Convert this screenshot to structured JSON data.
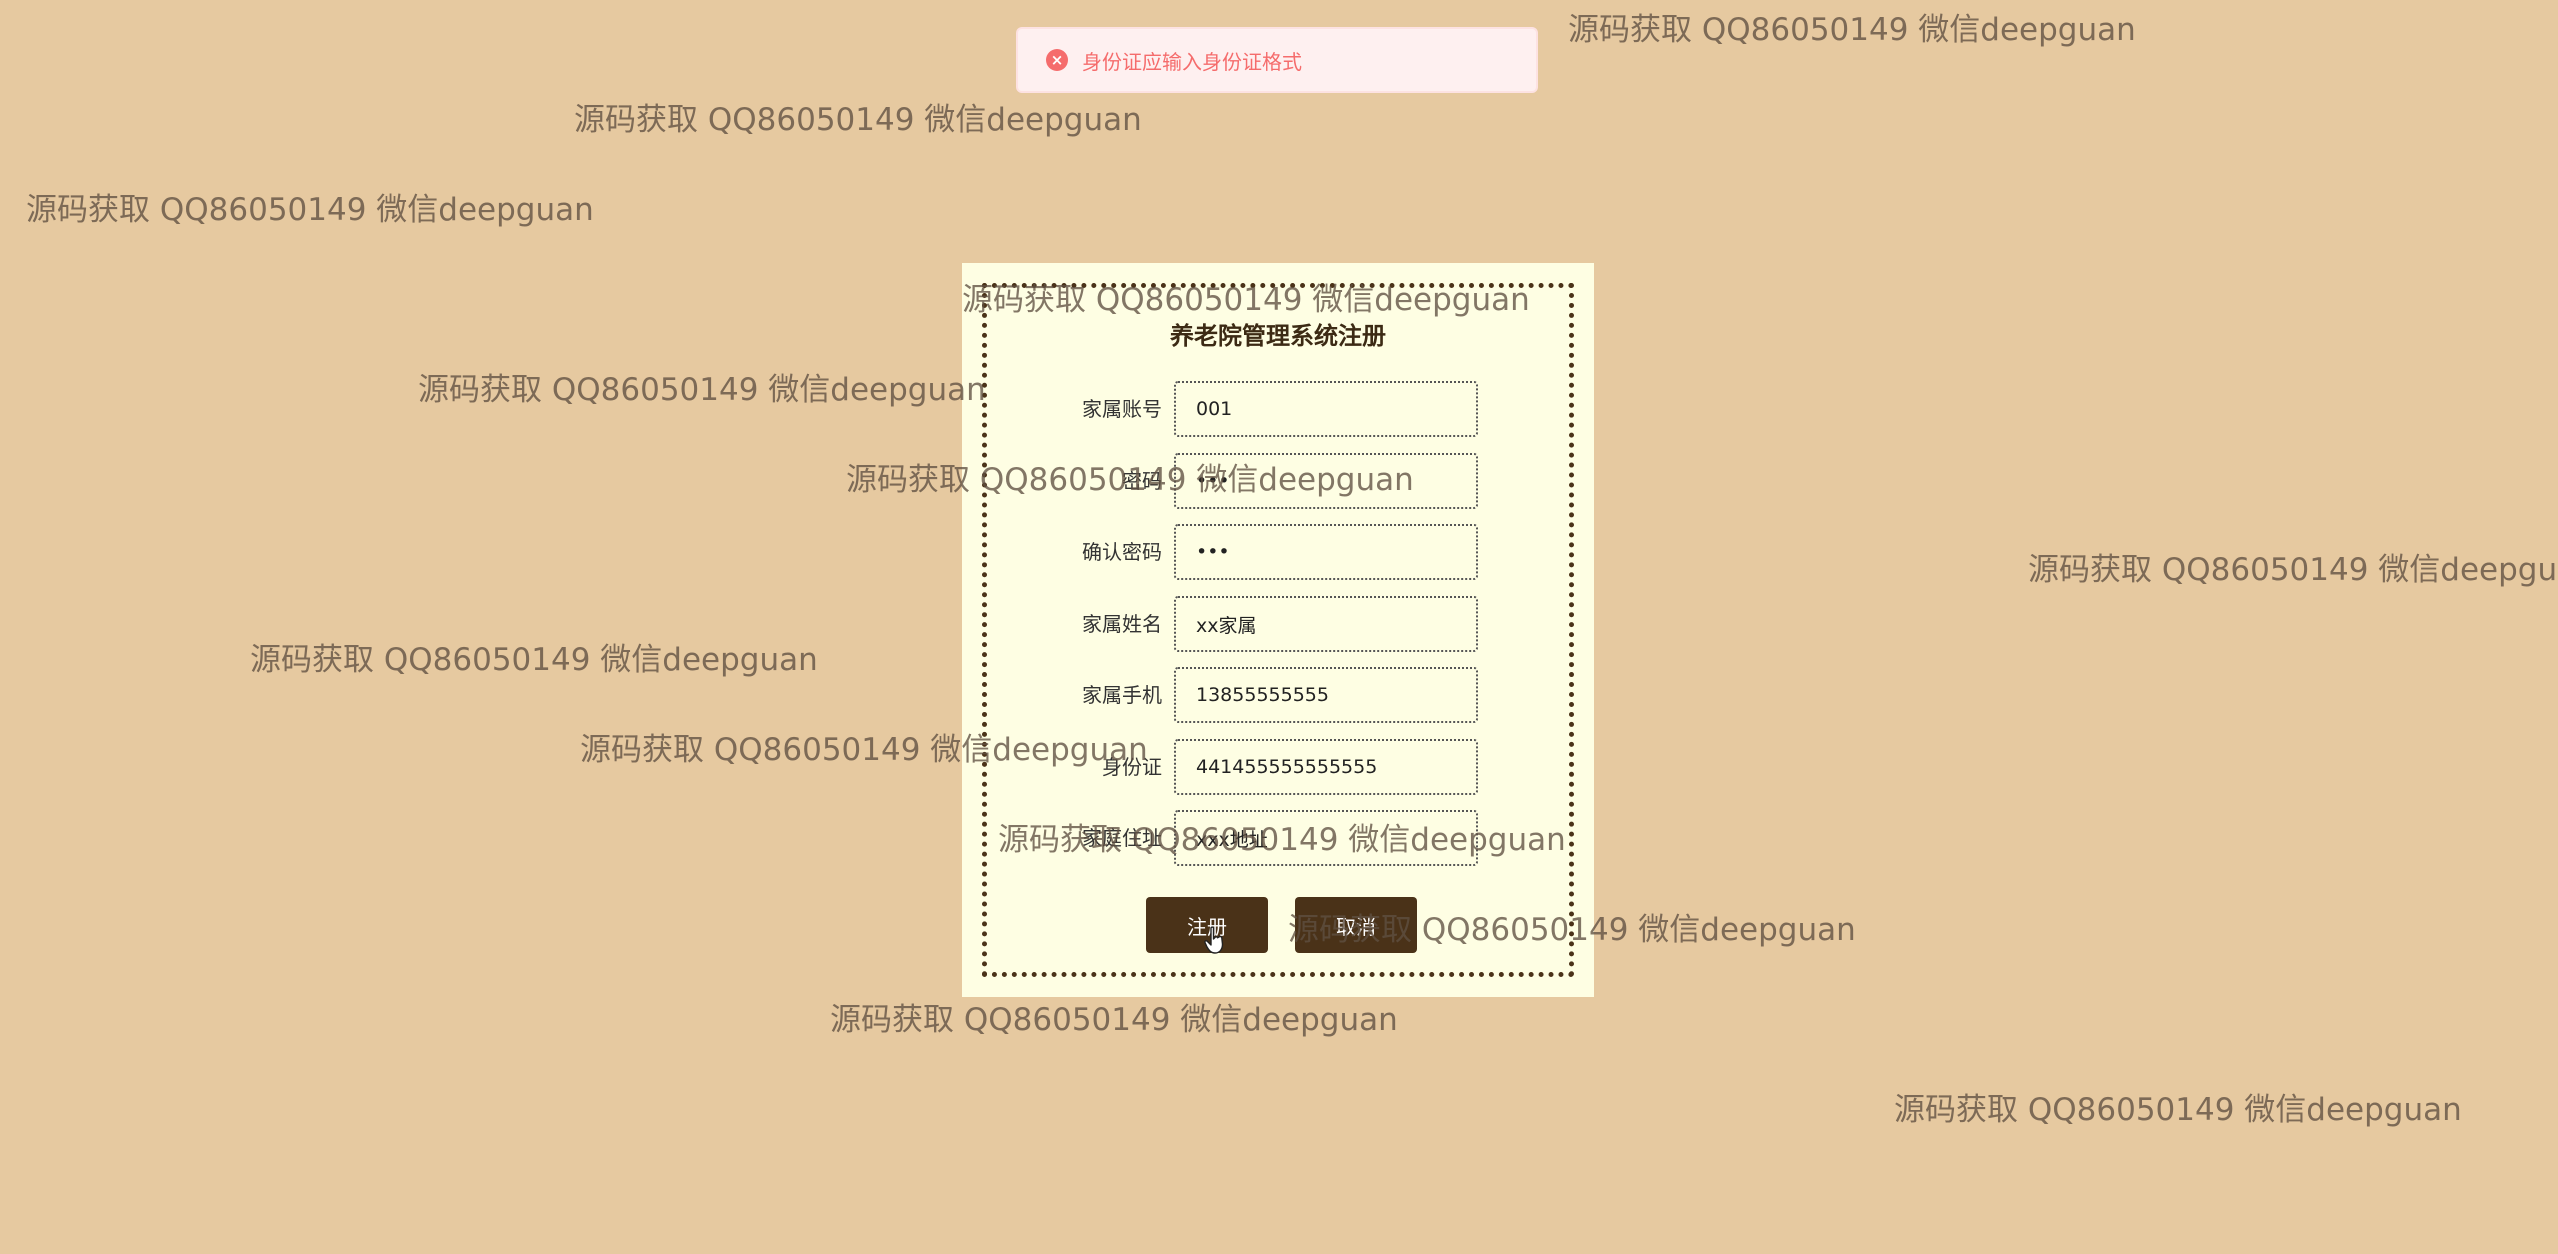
{
  "toast": {
    "icon": "error-circle-icon",
    "color": "#f56c6c",
    "message": "身份证应输入身份证格式"
  },
  "form": {
    "title": "养老院管理系统注册",
    "fields": [
      {
        "label": "家属账号",
        "value": "001"
      },
      {
        "label": "密码",
        "value": "•••"
      },
      {
        "label": "确认密码",
        "value": "•••"
      },
      {
        "label": "家属姓名",
        "value": "xx家属"
      },
      {
        "label": "家属手机",
        "value": "13855555555"
      },
      {
        "label": "身份证",
        "value": "441455555555555"
      },
      {
        "label": "家庭住址",
        "value": "xxx地址"
      }
    ],
    "register_label": "注册",
    "cancel_label": "取消"
  },
  "colors": {
    "background": "#e6c9a0",
    "card": "#fefee3",
    "accent": "#4a3218"
  },
  "watermark_text": "源码获取 QQ86050149 微信deepguan"
}
